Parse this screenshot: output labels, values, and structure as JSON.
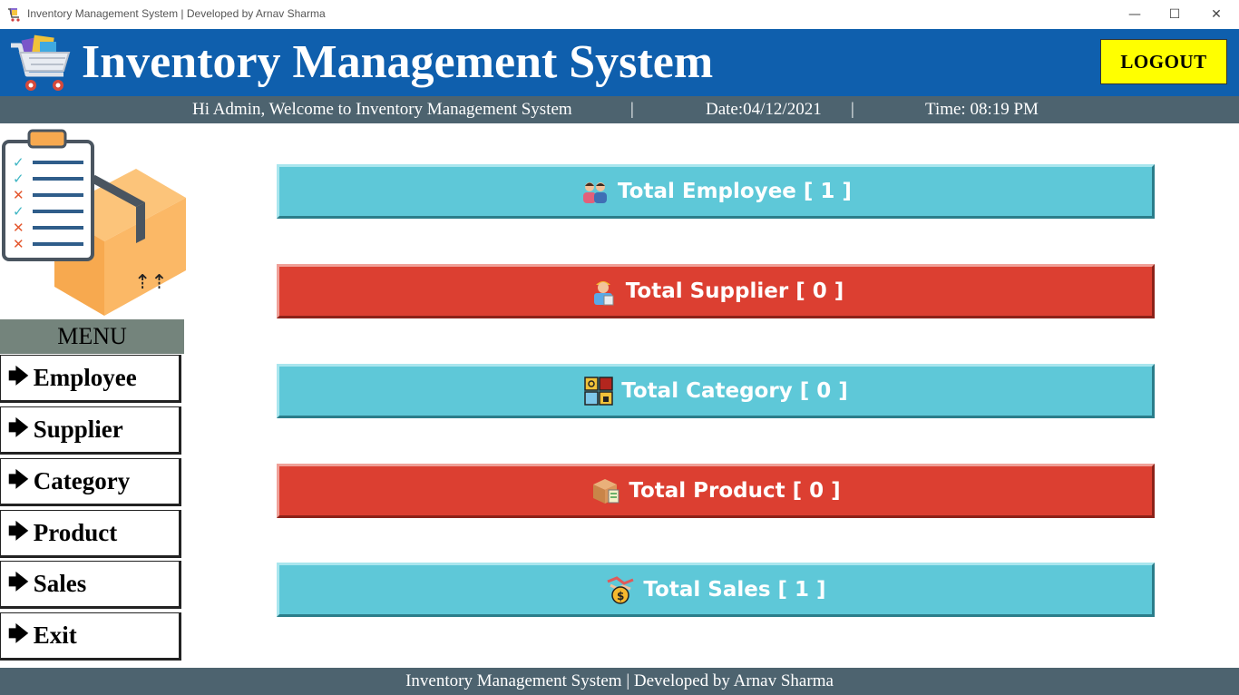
{
  "window": {
    "title": "Inventory Management System | Developed by Arnav Sharma",
    "controls": {
      "minimize": "—",
      "maximize": "☐",
      "close": "✕"
    }
  },
  "header": {
    "title": "Inventory Management System",
    "logout_label": "LOGOUT",
    "accent_color": "#0f5fad",
    "logout_color": "#ffff00"
  },
  "subheader": {
    "welcome": "Hi Admin, Welcome to Inventory Management System",
    "separator": "|",
    "date": "Date:04/12/2021",
    "time": "Time: 08:19 PM"
  },
  "menu": {
    "title": "MENU",
    "arrow": "🡆",
    "items": [
      {
        "label": "Employee"
      },
      {
        "label": "Supplier"
      },
      {
        "label": "Category"
      },
      {
        "label": "Product"
      },
      {
        "label": "Sales"
      },
      {
        "label": "Exit"
      }
    ]
  },
  "stats": [
    {
      "label": "Total Employee [ 1 ]",
      "icon": "employees-icon",
      "color": "#5ec8d8"
    },
    {
      "label": "Total Supplier [ 0 ]",
      "icon": "supplier-icon",
      "color": "#dc3f31"
    },
    {
      "label": "Total Category [ 0 ]",
      "icon": "category-icon",
      "color": "#5ec8d8"
    },
    {
      "label": "Total Product [ 0 ]",
      "icon": "product-box-icon",
      "color": "#dc3f31"
    },
    {
      "label": "Total Sales [ 1 ]",
      "icon": "sales-money-icon",
      "color": "#5ec8d8"
    }
  ],
  "footer": {
    "text": "Inventory Management System | Developed by Arnav Sharma"
  }
}
